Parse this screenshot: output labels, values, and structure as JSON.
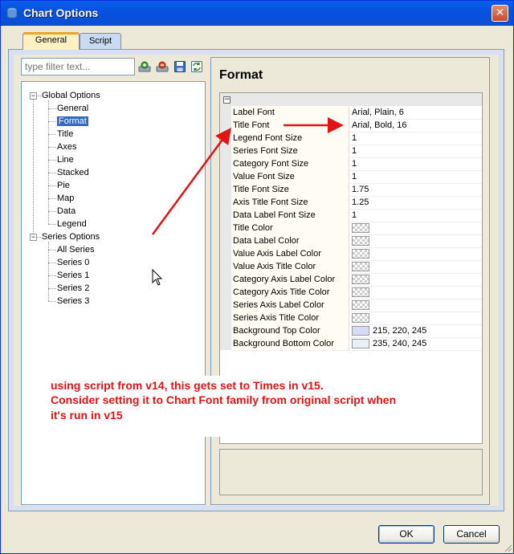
{
  "window": {
    "title": "Chart Options",
    "close_label": "✕"
  },
  "tabs": [
    {
      "label": "General"
    },
    {
      "label": "Script"
    }
  ],
  "filter": {
    "placeholder": "type filter text..."
  },
  "tree": {
    "global_label": "Global Options",
    "global_items": [
      "General",
      "Format",
      "Title",
      "Axes",
      "Line",
      "Stacked",
      "Pie",
      "Map",
      "Data",
      "Legend"
    ],
    "series_label": "Series Options",
    "series_items": [
      "All Series",
      "Series 0",
      "Series 1",
      "Series 2",
      "Series 3"
    ],
    "selected": "Format"
  },
  "panel": {
    "heading": "Format",
    "properties": [
      {
        "label": "Label Font",
        "value": "Arial, Plain, 6"
      },
      {
        "label": "Title Font",
        "value": "Arial, Bold, 16"
      },
      {
        "label": "Legend Font Size",
        "value": "1"
      },
      {
        "label": "Series Font Size",
        "value": "1"
      },
      {
        "label": "Category Font Size",
        "value": "1"
      },
      {
        "label": "Value Font Size",
        "value": "1"
      },
      {
        "label": "Title Font Size",
        "value": "1.75"
      },
      {
        "label": "Axis Title Font Size",
        "value": "1.25"
      },
      {
        "label": "Data Label Font Size",
        "value": "1"
      },
      {
        "label": "Title Color",
        "value": "",
        "swatch": "transparent"
      },
      {
        "label": "Data Label Color",
        "value": "",
        "swatch": "transparent"
      },
      {
        "label": "Value Axis Label Color",
        "value": "",
        "swatch": "transparent"
      },
      {
        "label": "Value Axis Title Color",
        "value": "",
        "swatch": "transparent"
      },
      {
        "label": "Category Axis Label Color",
        "value": "",
        "swatch": "transparent"
      },
      {
        "label": "Category Axis Title Color",
        "value": "",
        "swatch": "transparent"
      },
      {
        "label": "Series Axis Label Color",
        "value": "",
        "swatch": "transparent"
      },
      {
        "label": "Series Axis Title Color",
        "value": "",
        "swatch": "transparent"
      },
      {
        "label": "Background Top Color",
        "value": "215, 220, 245",
        "swatch": "#D7DCF5"
      },
      {
        "label": "Background Bottom Color",
        "value": "235, 240, 245",
        "swatch": "#EBF0F5"
      }
    ]
  },
  "annotation": {
    "lines": [
      "using script from v14, this gets set to Times in v15.",
      "Consider setting it to Chart Font family from original script when",
      "it's run in v15"
    ],
    "color": "#E01414"
  },
  "buttons": {
    "ok": "OK",
    "cancel": "Cancel"
  },
  "toolbar_icons": [
    "add-icon",
    "remove-icon",
    "save-icon",
    "refresh-icon"
  ]
}
